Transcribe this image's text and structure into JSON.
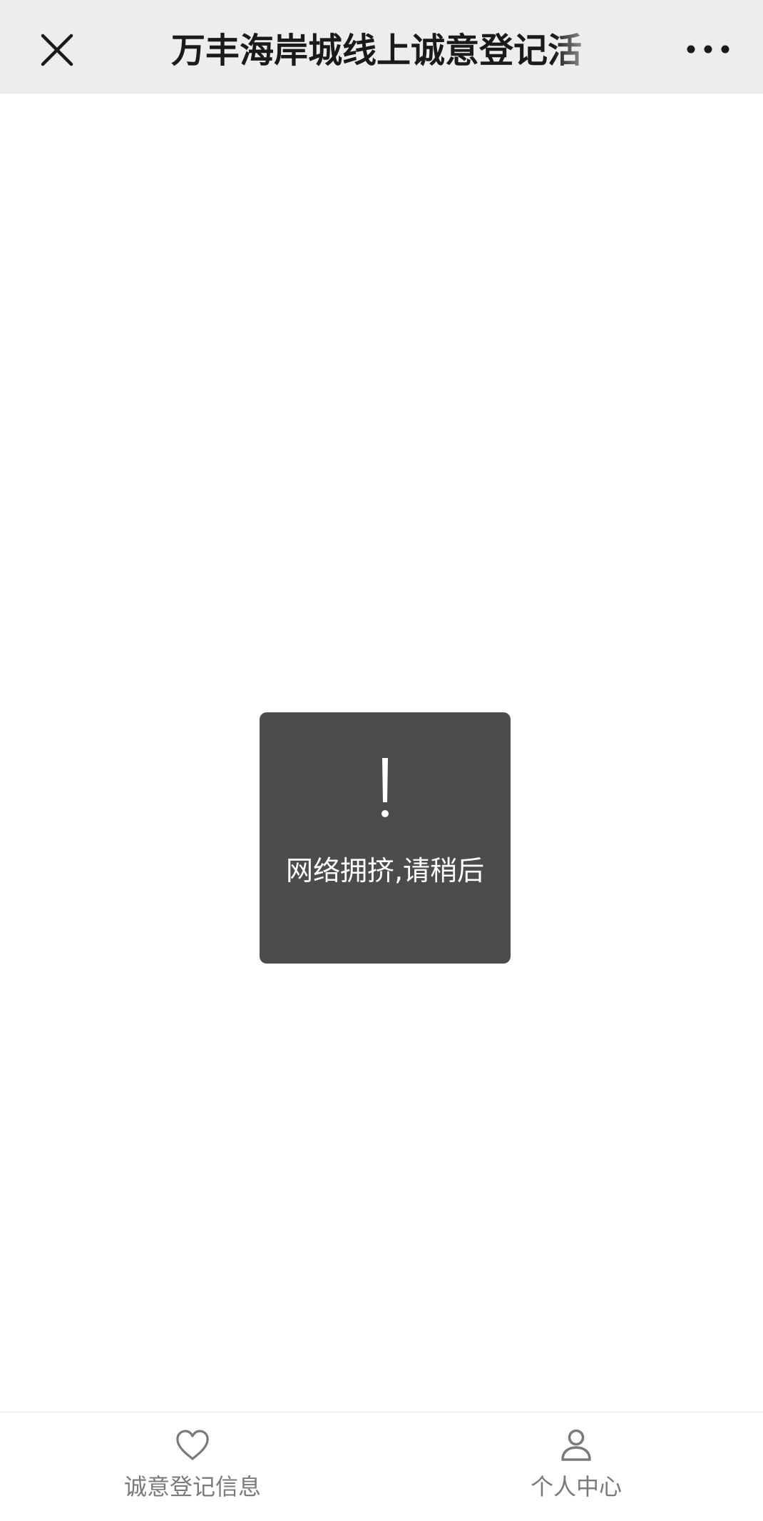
{
  "navbar": {
    "title": "万丰海岸城线上诚意登记活",
    "close_icon": "close-icon",
    "more_icon": "more-icon"
  },
  "toast": {
    "icon": "exclamation-icon",
    "message": "网络拥挤,请稍后"
  },
  "tabbar": {
    "tabs": [
      {
        "label": "诚意登记信息",
        "icon": "heart-icon"
      },
      {
        "label": "个人中心",
        "icon": "user-icon"
      }
    ]
  },
  "colors": {
    "navbar_bg": "#ededed",
    "toast_bg": "#4c4c4c",
    "tab_label": "#7a7a7a"
  }
}
